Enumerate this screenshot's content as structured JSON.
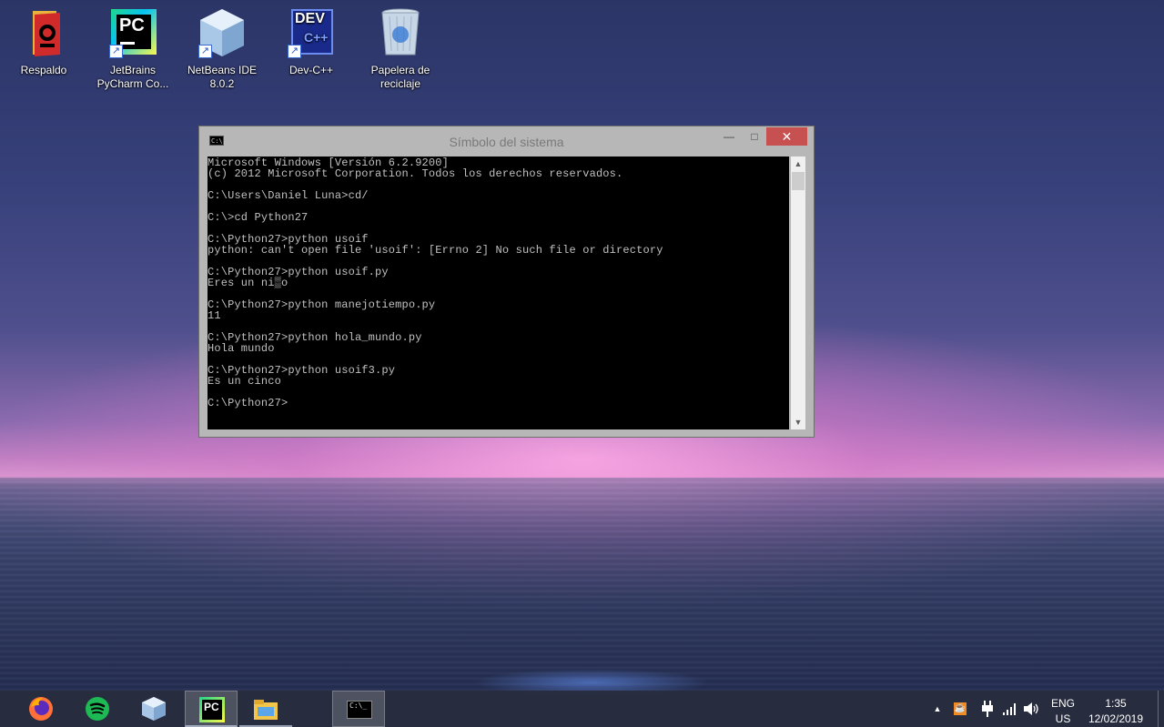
{
  "desktop": {
    "icons": [
      {
        "label": "Respaldo"
      },
      {
        "label": "JetBrains PyCharm Co..."
      },
      {
        "label": "NetBeans IDE 8.0.2"
      },
      {
        "label": "Dev-C++"
      },
      {
        "label": "Papelera de reciclaje"
      }
    ],
    "pycharm_badge": "PC",
    "devcpp_badge": "DEV",
    "devcpp_sub": "C++"
  },
  "window": {
    "title": "Símbolo del sistema",
    "icon_text": "C:\\",
    "minimize": "—",
    "maximize": "□",
    "close": "✕",
    "console_text": "Microsoft Windows [Versión 6.2.9200]\n(c) 2012 Microsoft Corporation. Todos los derechos reservados.\n\nC:\\Users\\Daniel Luna>cd/\n\nC:\\>cd Python27\n\nC:\\Python27>python usoif\npython: can't open file 'usoif': [Errno 2] No such file or directory\n\nC:\\Python27>python usoif.py\nEres un ni▒o\n\nC:\\Python27>python manejotiempo.py\n11\n\nC:\\Python27>python hola_mundo.py\nHola mundo\n\nC:\\Python27>python usoif3.py\nEs un cinco\n\nC:\\Python27>"
  },
  "taskbar": {
    "apps": [
      "firefox-icon",
      "spotify-icon",
      "netbeans-icon",
      "pycharm-icon",
      "file-explorer-icon",
      "cmd-icon"
    ],
    "pycharm_badge": "PC",
    "cmd_icon_text": "C:\\_"
  },
  "tray": {
    "show_hidden": "▲",
    "lang_top": "ENG",
    "lang_bottom": "US",
    "time": "1:35",
    "date": "12/02/2019"
  },
  "colors": {
    "close_button": "#c75050",
    "console_bg": "#000000",
    "console_text": "#c0c0c0",
    "pycharm": "#21d789",
    "spotify": "#1db954"
  }
}
